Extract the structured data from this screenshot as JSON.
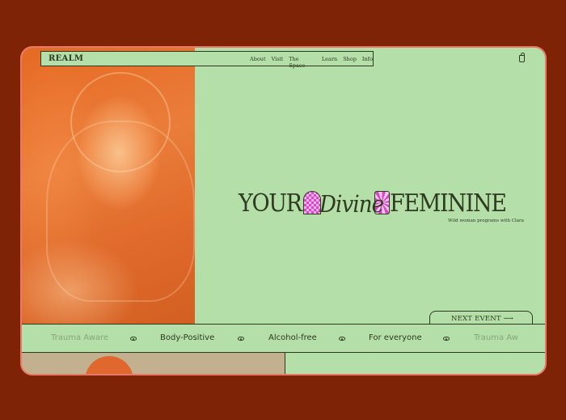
{
  "brand": {
    "logo": "REALM"
  },
  "nav": {
    "items": [
      "About",
      "Visit",
      "The Space",
      "Learn",
      "Shop",
      "Info"
    ]
  },
  "icons": {
    "cart": "shopping-bag-icon",
    "eye": "eye-icon",
    "arrow": "long-arrow-right-icon"
  },
  "hero": {
    "word1": "YOUR",
    "word2": "Divine",
    "word3": "FEMININE",
    "tagline": "Wild woman programs with Clara"
  },
  "next_event": {
    "label": "NEXT EVENT ⟶"
  },
  "ticker": {
    "items": [
      "Trauma Aware",
      "Body-Positive",
      "Alcohol-free",
      "For everyone",
      "Trauma Aw"
    ]
  },
  "colors": {
    "background": "#7e2306",
    "panel": "#b4dfa9",
    "ink": "#2f3a20",
    "accent": "#d948c8",
    "border": "#e8786a"
  }
}
